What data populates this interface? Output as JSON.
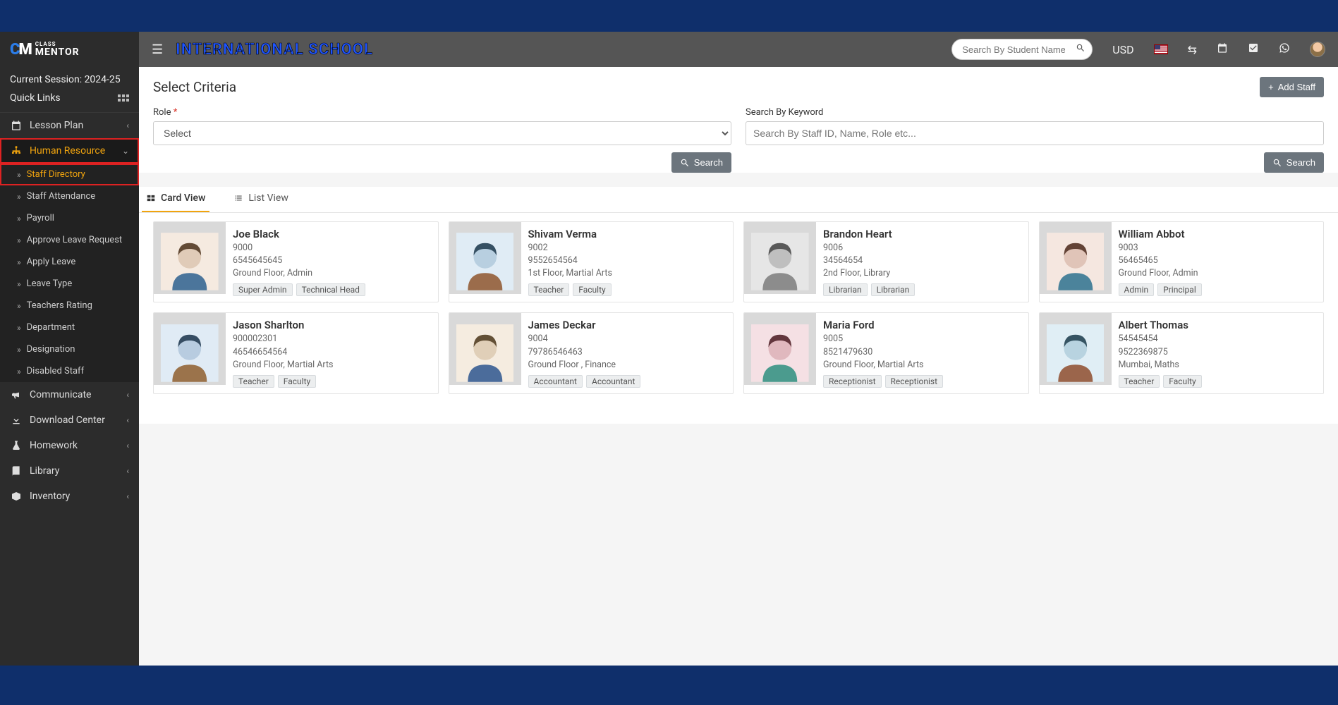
{
  "brand": {
    "logo_top": "CLASS",
    "logo_bottom": "MENTOR"
  },
  "session": {
    "label": "Current Session: 2024-25"
  },
  "quick_links": {
    "label": "Quick Links"
  },
  "sidebar": {
    "top_items": [
      {
        "label": "Lesson Plan",
        "icon": "calendar"
      }
    ],
    "hr": {
      "label": "Human Resource"
    },
    "hr_children": [
      {
        "label": "Staff Directory",
        "active": true
      },
      {
        "label": "Staff Attendance"
      },
      {
        "label": "Payroll"
      },
      {
        "label": "Approve Leave Request"
      },
      {
        "label": "Apply Leave"
      },
      {
        "label": "Leave Type"
      },
      {
        "label": "Teachers Rating"
      },
      {
        "label": "Department"
      },
      {
        "label": "Designation"
      },
      {
        "label": "Disabled Staff"
      }
    ],
    "bottom_items": [
      {
        "label": "Communicate",
        "icon": "bullhorn"
      },
      {
        "label": "Download Center",
        "icon": "download"
      },
      {
        "label": "Homework",
        "icon": "flask"
      },
      {
        "label": "Library",
        "icon": "book"
      },
      {
        "label": "Inventory",
        "icon": "box"
      }
    ]
  },
  "header": {
    "school_name": "INTERNATIONAL SCHOOL",
    "search_placeholder": "Search By Student Name",
    "currency": "USD"
  },
  "page": {
    "title": "Select Criteria",
    "add_staff_btn": "Add Staff",
    "role_label": "Role",
    "role_selected": "Select",
    "keyword_label": "Search By Keyword",
    "keyword_placeholder": "Search By Staff ID, Name, Role etc...",
    "search_btn": "Search",
    "tabs": {
      "card_view": "Card View",
      "list_view": "List View"
    }
  },
  "staff": [
    {
      "name": "Joe Black",
      "id": "9000",
      "phone": "6545645645",
      "dept": "Ground Floor, Admin",
      "tags": [
        "Super Admin",
        "Technical Head"
      ],
      "hue": 28
    },
    {
      "name": "Shivam Verma",
      "id": "9002",
      "phone": "9552654564",
      "dept": "1st Floor, Martial Arts",
      "tags": [
        "Teacher",
        "Faculty"
      ],
      "hue": 205
    },
    {
      "name": "Brandon Heart",
      "id": "9006",
      "phone": "34564654",
      "dept": "2nd Floor, Library",
      "tags": [
        "Librarian",
        "Librarian"
      ],
      "hue": 0,
      "gray": true
    },
    {
      "name": "William Abbot",
      "id": "9003",
      "phone": "56465465",
      "dept": "Ground Floor, Admin",
      "tags": [
        "Admin",
        "Principal"
      ],
      "hue": 18
    },
    {
      "name": "Jason Sharlton",
      "id": "900002301",
      "phone": "46546654564",
      "dept": "Ground Floor, Martial Arts",
      "tags": [
        "Teacher",
        "Faculty"
      ],
      "hue": 210
    },
    {
      "name": "James Deckar",
      "id": "9004",
      "phone": "79786546463",
      "dept": "Ground Floor , Finance",
      "tags": [
        "Accountant",
        "Accountant"
      ],
      "hue": 35
    },
    {
      "name": "Maria Ford",
      "id": "9005",
      "phone": "8521479630",
      "dept": "Ground Floor, Martial Arts",
      "tags": [
        "Receptionist",
        "Receptionist"
      ],
      "hue": 350
    },
    {
      "name": "Albert Thomas",
      "id": "54545454",
      "phone": "9522369875",
      "dept": "Mumbai, Maths",
      "tags": [
        "Teacher",
        "Faculty"
      ],
      "hue": 200
    }
  ]
}
